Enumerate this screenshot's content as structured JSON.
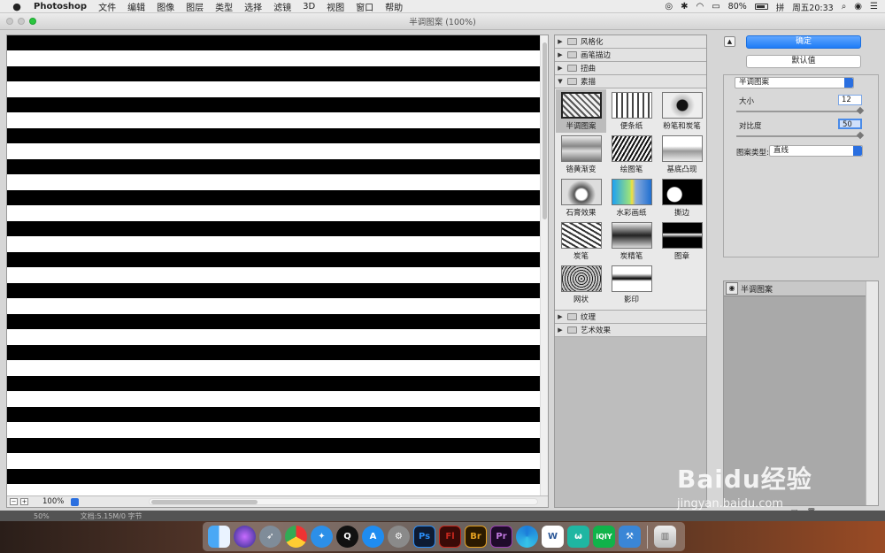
{
  "menubar": {
    "app": "Photoshop",
    "items": [
      "文件",
      "编辑",
      "图像",
      "图层",
      "类型",
      "选择",
      "滤镜",
      "3D",
      "视图",
      "窗口",
      "帮助"
    ],
    "battery": "80%",
    "input_method": "拼",
    "clock": "周五20:33"
  },
  "window": {
    "title": "半调图案 (100%)"
  },
  "canvas": {
    "zoom": "100%"
  },
  "filter_gallery": {
    "categories_top": [
      {
        "label": "风格化",
        "expanded": false
      },
      {
        "label": "画笔描边",
        "expanded": false
      },
      {
        "label": "扭曲",
        "expanded": false
      },
      {
        "label": "素描",
        "expanded": true
      }
    ],
    "sketch_filters": [
      "半调图案",
      "便条纸",
      "粉笔和炭笔",
      "铬黄渐变",
      "绘图笔",
      "基底凸现",
      "石膏效果",
      "水彩画纸",
      "撕边",
      "炭笔",
      "炭精笔",
      "图章",
      "网状",
      "影印"
    ],
    "selected": "半调图案",
    "categories_bottom": [
      {
        "label": "纹理",
        "expanded": false
      },
      {
        "label": "艺术效果",
        "expanded": false
      }
    ]
  },
  "settings": {
    "ok_label": "确定",
    "default_label": "默认值",
    "filter_select": "半调图案",
    "size_label": "大小",
    "size_value": "12",
    "size_fraction": 1.0,
    "contrast_label": "对比度",
    "contrast_value": "50",
    "contrast_fraction": 1.0,
    "pattern_type_label": "图案类型:",
    "pattern_type_value": "直线"
  },
  "effect_layers": {
    "items": [
      "半调图案"
    ]
  },
  "status_bar": {
    "zoom": "50%",
    "doc_info": "文档:5.15M/0 字节"
  },
  "dock": {
    "icons": [
      "finder-icon",
      "siri-icon",
      "launchpad-icon",
      "chrome-icon",
      "safari-icon",
      "qq-icon",
      "appstore-icon",
      "system-preferences-icon",
      "photoshop-icon",
      "flash-icon",
      "bridge-icon",
      "premiere-icon",
      "browser-icon",
      "word-icon",
      "wunderlist-icon",
      "iqiyi-icon",
      "tools-icon",
      "trash-icon"
    ],
    "labels": {
      "ps": "Ps",
      "fl": "Fl",
      "br": "Br",
      "pr": "Pr",
      "w": "W",
      "iqiyi": "iQIY"
    }
  },
  "watermark": {
    "logo": "Baidu经验",
    "url": "jingyan.baidu.com"
  },
  "colors": {
    "accent": "#1f7cf6",
    "ps_blue": "#2b8df5",
    "flash_red": "#c8281e",
    "bridge_orange": "#e5a121",
    "premiere_purple": "#9b3fb3"
  }
}
